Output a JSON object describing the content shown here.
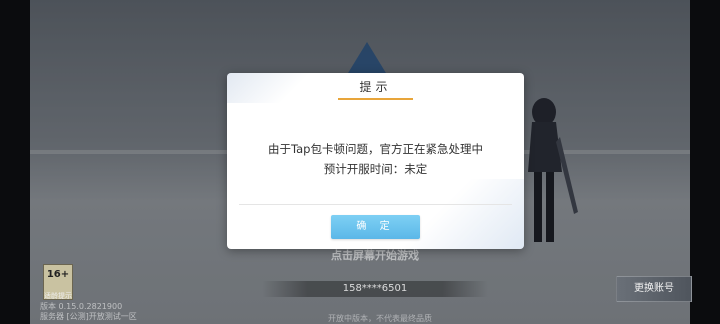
{
  "dialog": {
    "title": "提示",
    "message_line1": "由于Tap包卡顿问题，官方正在紧急处理中",
    "message_line2": "预计开服时间：未定",
    "confirm_label": "确 定"
  },
  "background": {
    "age_rating": "16+",
    "age_tip": "适龄提示",
    "version_line1": "版本 0.15.0.2821900",
    "version_line2": "服务器 [公测]开放测试一区",
    "center_title": "点击屏幕开始游戏",
    "account_phone": "158****6501",
    "switch_account_label": "更换账号",
    "bottom_tip": "开放中版本，不代表最终品质"
  },
  "colors": {
    "accent_underline": "#e8a53a",
    "confirm_button": "#5bb7e8"
  }
}
